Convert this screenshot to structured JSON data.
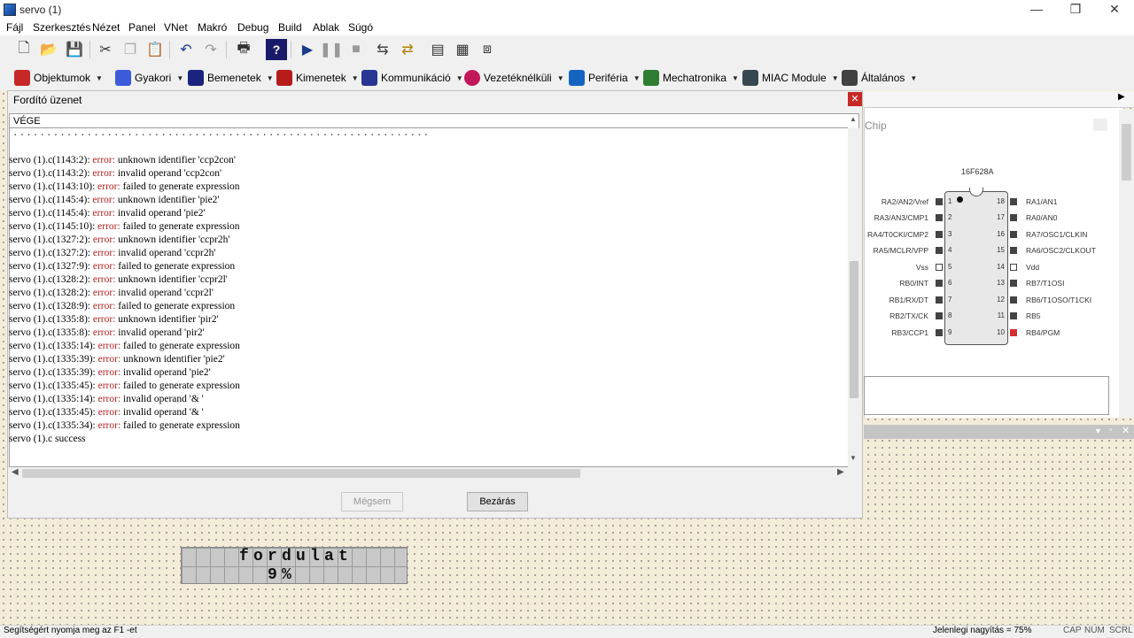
{
  "window": {
    "title": "servo (1)"
  },
  "menu": [
    "Fájl",
    "Szerkesztés",
    "Nézet",
    "Panel",
    "VNet",
    "Makró",
    "Debug",
    "Build",
    "Ablak",
    "Súgó"
  ],
  "categories": [
    "Objektumok",
    "Gyakori",
    "Bemenetek",
    "Kimenetek",
    "Kommunikáció",
    "Vezetéknélküli",
    "Periféria",
    "Mechatronika",
    "MIAC Module",
    "Általános"
  ],
  "dialog": {
    "title": "Fordító üzenet",
    "header": "VÉGE",
    "dots": "..............................................................",
    "log": [
      {
        "loc": "servo (1).c(1143:2): ",
        "kw": "error:",
        "msg": " unknown identifier 'ccp2con'"
      },
      {
        "loc": "servo (1).c(1143:2): ",
        "kw": "error:",
        "msg": " invalid operand 'ccp2con'"
      },
      {
        "loc": "servo (1).c(1143:10): ",
        "kw": "error:",
        "msg": " failed to generate expression"
      },
      {
        "loc": "servo (1).c(1145:4): ",
        "kw": "error:",
        "msg": " unknown identifier 'pie2'"
      },
      {
        "loc": "servo (1).c(1145:4): ",
        "kw": "error:",
        "msg": " invalid operand 'pie2'"
      },
      {
        "loc": "servo (1).c(1145:10): ",
        "kw": "error:",
        "msg": " failed to generate expression"
      },
      {
        "loc": "servo (1).c(1327:2): ",
        "kw": "error:",
        "msg": " unknown identifier 'ccpr2h'"
      },
      {
        "loc": "servo (1).c(1327:2): ",
        "kw": "error:",
        "msg": " invalid operand 'ccpr2h'"
      },
      {
        "loc": "servo (1).c(1327:9): ",
        "kw": "error:",
        "msg": " failed to generate expression"
      },
      {
        "loc": "servo (1).c(1328:2): ",
        "kw": "error:",
        "msg": " unknown identifier 'ccpr2l'"
      },
      {
        "loc": "servo (1).c(1328:2): ",
        "kw": "error:",
        "msg": " invalid operand 'ccpr2l'"
      },
      {
        "loc": "servo (1).c(1328:9): ",
        "kw": "error:",
        "msg": " failed to generate expression"
      },
      {
        "loc": "servo (1).c(1335:8): ",
        "kw": "error:",
        "msg": " unknown identifier 'pir2'"
      },
      {
        "loc": "servo (1).c(1335:8): ",
        "kw": "error:",
        "msg": " invalid operand 'pir2'"
      },
      {
        "loc": "servo (1).c(1335:14): ",
        "kw": "error:",
        "msg": " failed to generate expression"
      },
      {
        "loc": "servo (1).c(1335:39): ",
        "kw": "error:",
        "msg": " unknown identifier 'pie2'"
      },
      {
        "loc": "servo (1).c(1335:39): ",
        "kw": "error:",
        "msg": " invalid operand 'pie2'"
      },
      {
        "loc": "servo (1).c(1335:45): ",
        "kw": "error:",
        "msg": " failed to generate expression"
      },
      {
        "loc": "servo (1).c(1335:14): ",
        "kw": "error:",
        "msg": " invalid operand '& '"
      },
      {
        "loc": "servo (1).c(1335:45): ",
        "kw": "error:",
        "msg": " invalid operand '& '"
      },
      {
        "loc": "servo (1).c(1335:34): ",
        "kw": "error:",
        "msg": " failed to generate expression"
      },
      {
        "loc": "servo (1).c success",
        "kw": "",
        "msg": ""
      }
    ],
    "cancel_label": "Mégsem",
    "close_label": "Bezárás"
  },
  "chip": {
    "panel_label": "Chip",
    "name": "16F628A",
    "left_pins": [
      {
        "n": "1",
        "label": "RA2/AN2/Vref"
      },
      {
        "n": "2",
        "label": "RA3/AN3/CMP1"
      },
      {
        "n": "3",
        "label": "RA4/T0CKI/CMP2"
      },
      {
        "n": "4",
        "label": "RA5/MCLR/VPP"
      },
      {
        "n": "5",
        "label": "Vss"
      },
      {
        "n": "6",
        "label": "RB0/INT"
      },
      {
        "n": "7",
        "label": "RB1/RX/DT"
      },
      {
        "n": "8",
        "label": "RB2/TX/CK"
      },
      {
        "n": "9",
        "label": "RB3/CCP1"
      }
    ],
    "right_pins": [
      {
        "n": "18",
        "label": "RA1/AN1"
      },
      {
        "n": "17",
        "label": "RA0/AN0"
      },
      {
        "n": "16",
        "label": "RA7/OSC1/CLKIN"
      },
      {
        "n": "15",
        "label": "RA6/OSC2/CLKOUT"
      },
      {
        "n": "14",
        "label": "Vdd"
      },
      {
        "n": "13",
        "label": "RB7/T1OSI"
      },
      {
        "n": "12",
        "label": "RB6/T1OSO/T1CKI"
      },
      {
        "n": "11",
        "label": "RB5"
      },
      {
        "n": "10",
        "label": "RB4/PGM"
      }
    ],
    "active_pin_color": "#d32f2f"
  },
  "lcd": {
    "line1": "fordulat",
    "line2": "9%"
  },
  "status": {
    "help": "Segítségért nyomja meg az F1 -et",
    "zoom": "Jelenlegi nagyítás = 75%",
    "caps": "CAP",
    "num": "NUM",
    "scrl": "SCRL"
  }
}
